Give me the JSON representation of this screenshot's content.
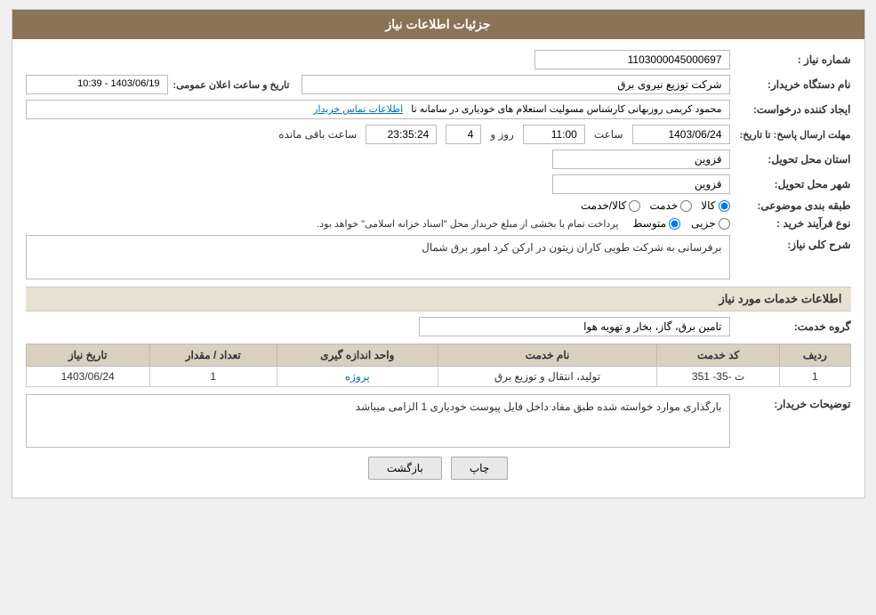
{
  "header": {
    "title": "جزئیات اطلاعات نیاز"
  },
  "fields": {
    "need_number_label": "شماره نیاز :",
    "need_number_value": "1103000045000697",
    "buyer_org_label": "نام دستگاه خریدار:",
    "buyer_org_value": "شرکت توزیع نیروی برق",
    "creator_label": "ایجاد کننده درخواست:",
    "creator_value": "محمود کریمی روزبهانی کارشناس  مسولیت استعلام های خودیاری در سامانه تا",
    "creator_link": "اطلاعات تماس خریدار",
    "announce_label": "تاریخ و ساعت اعلان عمومی:",
    "announce_value": "1403/06/19 - 10:39",
    "deadline_label": "مهلت ارسال پاسخ: تا تاریخ:",
    "deadline_date": "1403/06/24",
    "deadline_time_label": "ساعت",
    "deadline_time": "11:00",
    "deadline_days_label": "روز و",
    "deadline_days": "4",
    "deadline_remaining_label": "ساعت باقی مانده",
    "deadline_remaining": "23:35:24",
    "province_label": "استان محل تحویل:",
    "province_value": "قزوین",
    "city_label": "شهر محل تحویل:",
    "city_value": "قزوین",
    "category_label": "طبقه بندی موضوعی:",
    "category_options": [
      "کالا",
      "خدمت",
      "کالا/خدمت"
    ],
    "category_selected": "کالا",
    "purchase_type_label": "نوع فرآیند خرید :",
    "purchase_type_options": [
      "جزیی",
      "متوسط"
    ],
    "purchase_type_selected": "متوسط",
    "purchase_type_desc": "پرداخت تمام یا بخشی از مبلغ خریدار محل \"اسناد خزانه اسلامی\" خواهد بود.",
    "need_desc_label": "شرح کلی نیاز:",
    "need_desc_value": "برفرسانی به شرکت طویی کاران زیتون در ارکن کرد امور برق شمال",
    "services_header": "اطلاعات خدمات مورد نیاز",
    "service_group_label": "گروه خدمت:",
    "service_group_value": "تامین برق، گاز، بخار و تهویه هوا",
    "table": {
      "columns": [
        "ردیف",
        "کد خدمت",
        "نام خدمت",
        "واحد اندازه گیری",
        "تعداد / مقدار",
        "تاریخ نیاز"
      ],
      "rows": [
        {
          "row_num": "1",
          "service_code": "ت -35- 351",
          "service_name": "تولید، انتقال و توزیع برق",
          "unit": "پروژه",
          "quantity": "1",
          "date": "1403/06/24"
        }
      ]
    },
    "buyer_notes_label": "توضیحات خریدار:",
    "buyer_notes_value": "بارگذاری موارد خواسته شده طبق مفاد داخل فایل پیوست خودیاری 1 الزامی میباشد",
    "btn_back": "بازگشت",
    "btn_print": "چاپ"
  }
}
